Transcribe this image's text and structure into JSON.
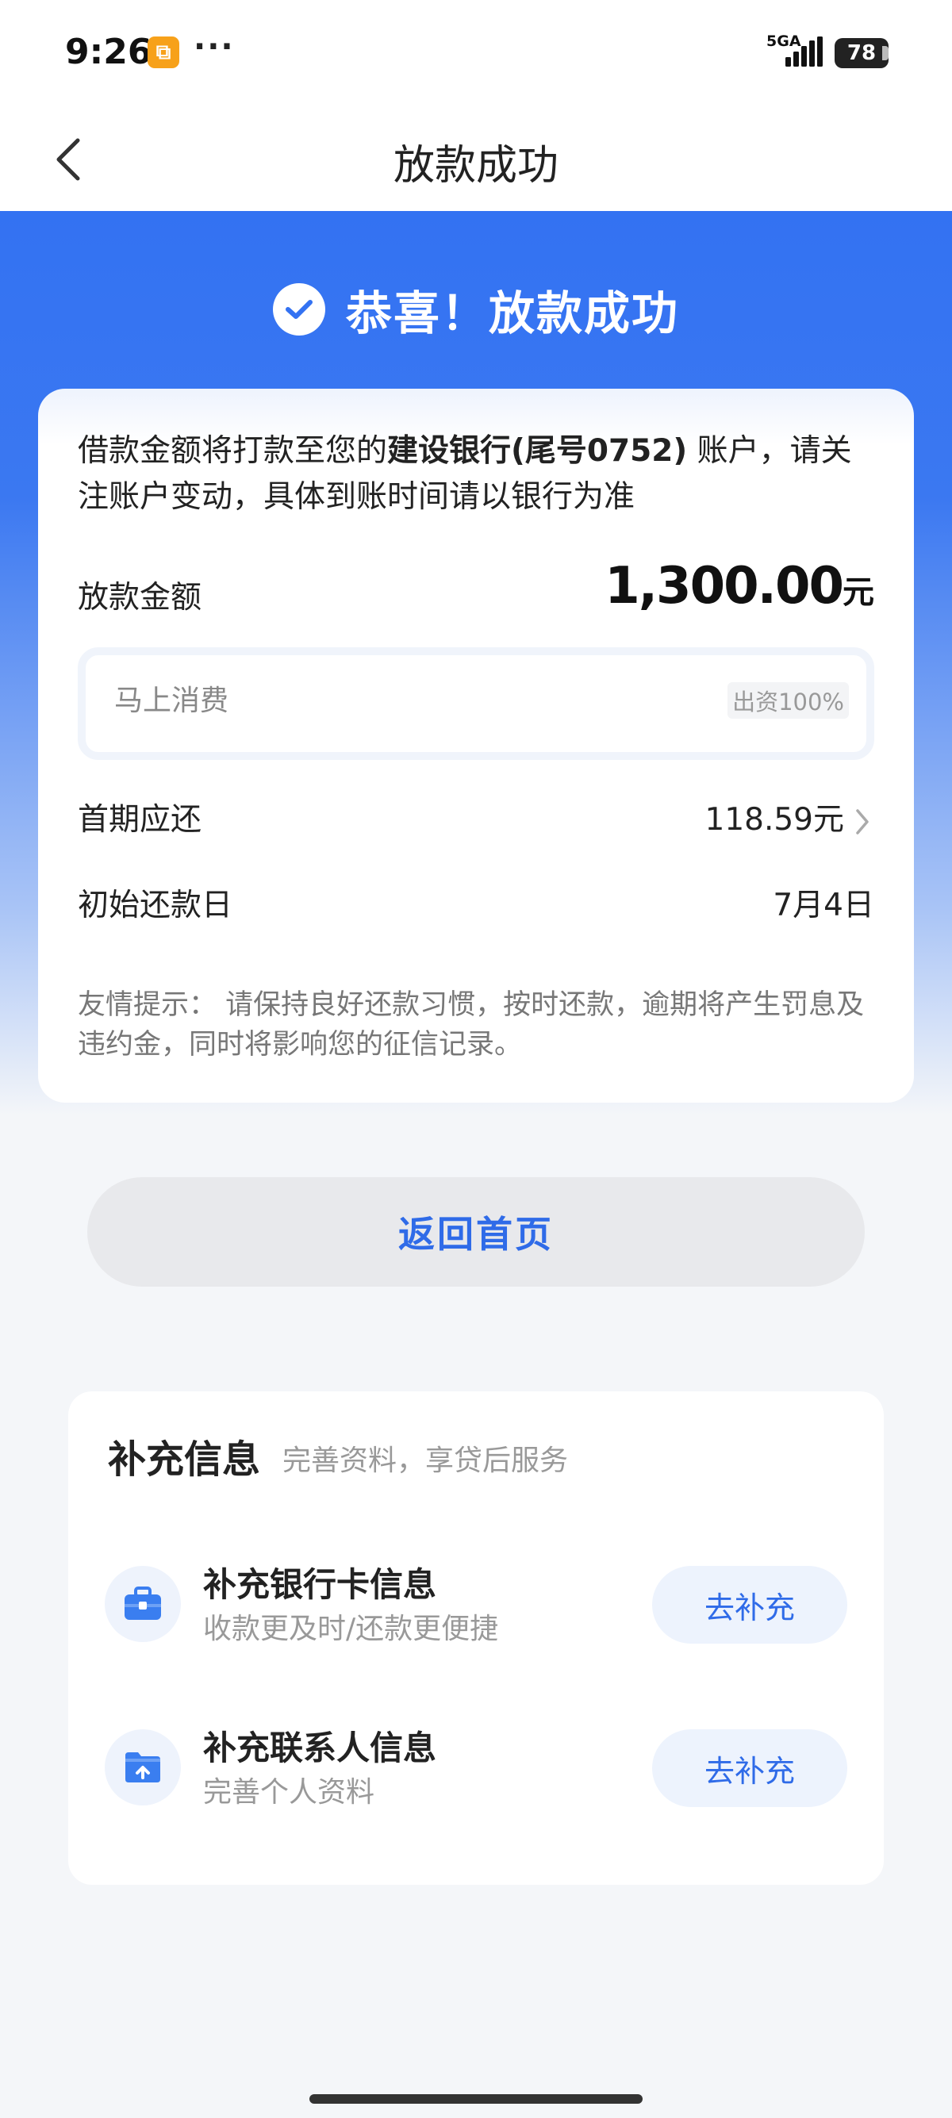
{
  "status_bar": {
    "time": "9:26",
    "app_icon_glyph": "⧉",
    "dots": "···",
    "network": "5GA",
    "battery": "78"
  },
  "nav": {
    "title": "放款成功"
  },
  "banner": {
    "text": "恭喜！放款成功"
  },
  "card": {
    "notice_pre": "借款金额将打款至您的",
    "notice_bank": "建设银行(尾号0752)",
    "notice_post": " 账户，请关注账户变动，具体到账时间请以银行为准",
    "amount_label": "放款金额",
    "amount_value": "1,300.00",
    "amount_unit": "元",
    "lender_name": "马上消费",
    "lender_share": "出资100%",
    "first_payment_label": "首期应还",
    "first_payment_value": "118.59元",
    "start_date_label": "初始还款日",
    "start_date_value": "7月4日",
    "tip": "友情提示： 请保持良好还款习惯，按时还款，逾期将产生罚息及违约金，同时将影响您的征信记录。"
  },
  "home_button": "返回首页",
  "supplement": {
    "title": "补充信息",
    "subtitle": "完善资料，享贷后服务",
    "items": [
      {
        "name": "补充银行卡信息",
        "desc": "收款更及时/还款更便捷",
        "button": "去补充",
        "icon": "briefcase-icon"
      },
      {
        "name": "补充联系人信息",
        "desc": "完善个人资料",
        "button": "去补充",
        "icon": "folder-upload-icon"
      }
    ]
  },
  "colors": {
    "primary": "#3372f2",
    "accent_text": "#2f6be8"
  }
}
